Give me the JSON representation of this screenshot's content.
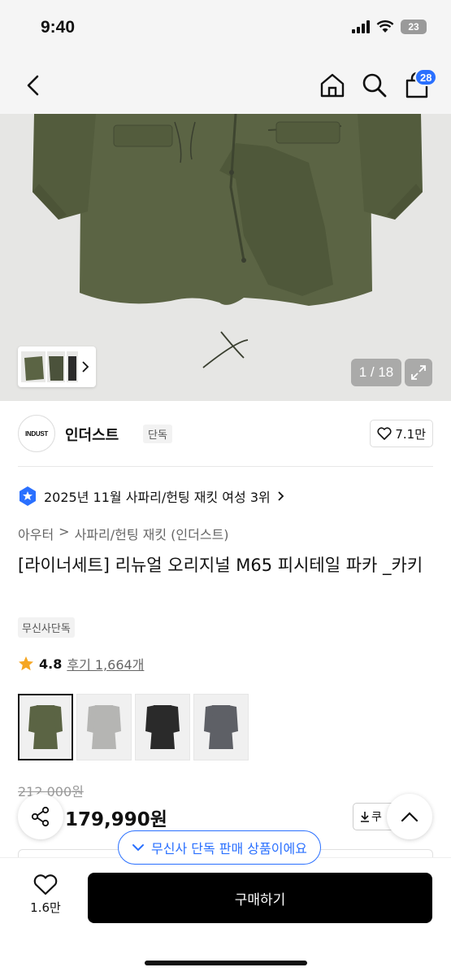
{
  "status_bar": {
    "time": "9:40",
    "battery": "23"
  },
  "nav": {
    "cart_count": "28"
  },
  "gallery": {
    "counter": "1 / 18"
  },
  "brand": {
    "logo_text": "INDUST",
    "name": "인더스트",
    "tag": "단독",
    "likes": "7.1만"
  },
  "ranking": {
    "text": "2025년 11월 사파리/헌팅 재킷 여성 3위"
  },
  "breadcrumb": {
    "level1": "아우터",
    "level2": "사파리/헌팅 재킷 (인더스트)"
  },
  "product": {
    "title": "[라이너세트] 리뉴얼 오리지널 M65 피시테일 파카 _카키",
    "exclusive_tag": "무신사단독",
    "rating": "4.8",
    "reviews": "후기 1,664개",
    "original_price": "212,000원",
    "sale_price": "179,990원"
  },
  "color_options": [
    {
      "color": "#5b6444",
      "selected": true
    },
    {
      "color": "#b5b5b3",
      "selected": false
    },
    {
      "color": "#2a2a2a",
      "selected": false
    },
    {
      "color": "#5e6066",
      "selected": false
    }
  ],
  "coupon": {
    "label": "쿠"
  },
  "exclusive_pill": {
    "text": "무신사 단독 판매 상품이에요"
  },
  "bottom": {
    "wish_count": "1.6만",
    "buy_label": "구매하기"
  },
  "colors": {
    "accent": "#2a70ff",
    "jacket": "#5b6444"
  }
}
